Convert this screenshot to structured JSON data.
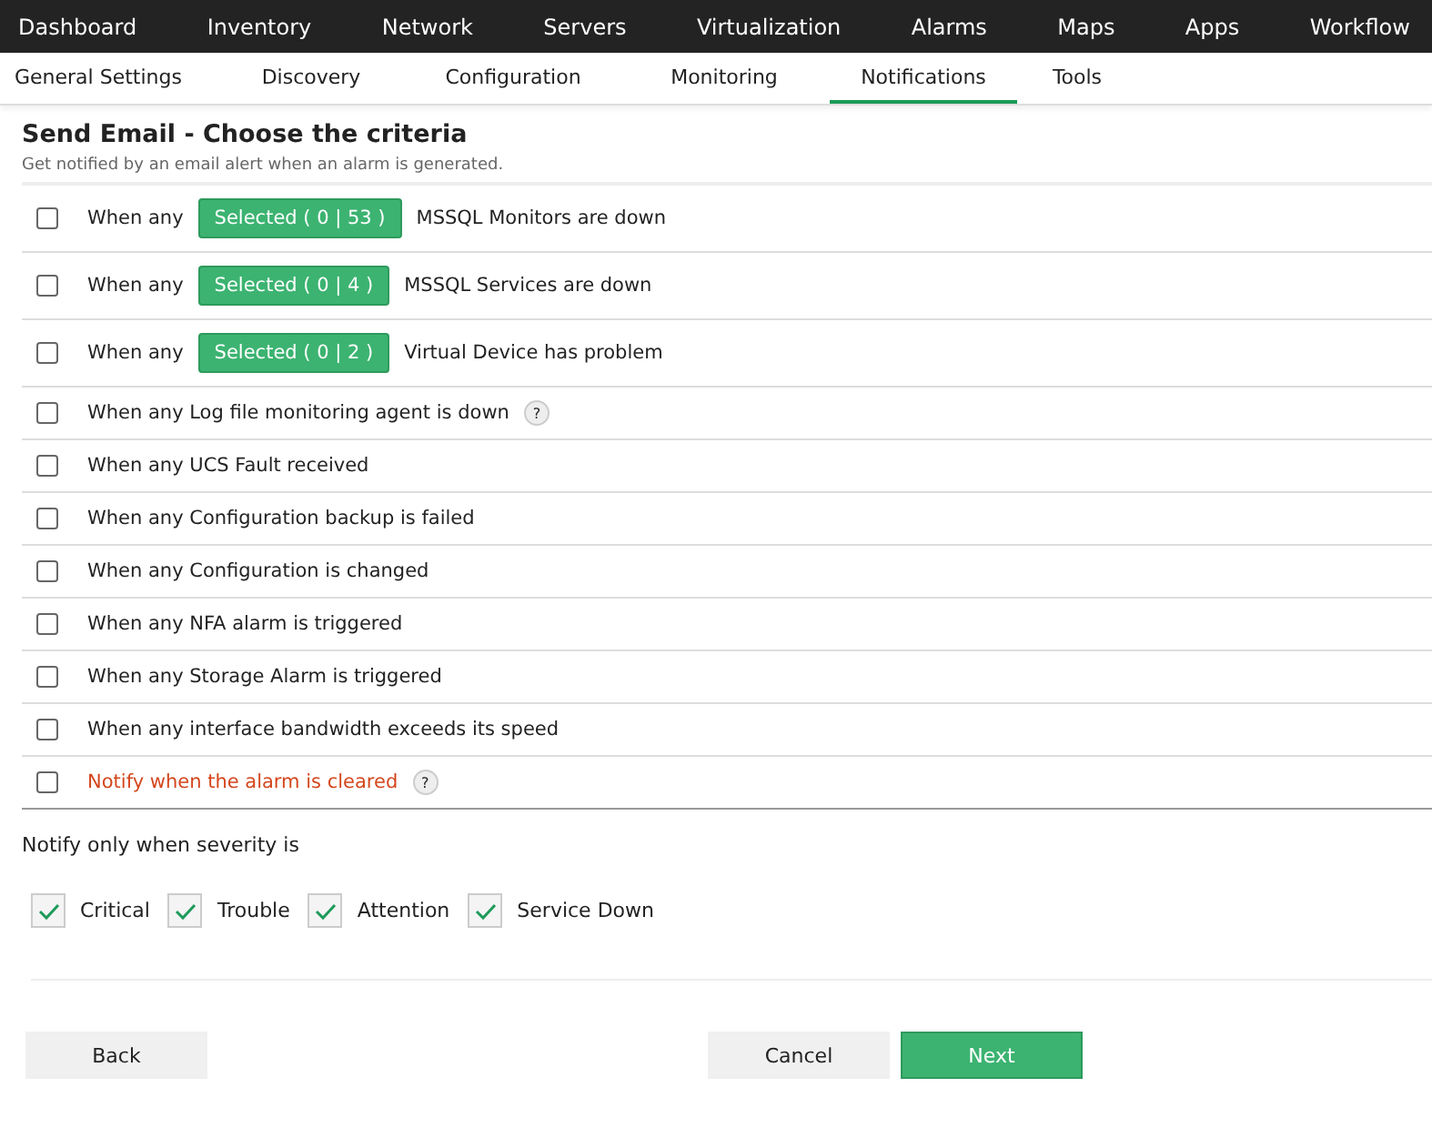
{
  "top_nav": [
    {
      "label": "Dashboard",
      "selected": false
    },
    {
      "label": "Inventory",
      "selected": false
    },
    {
      "label": "Network",
      "selected": false
    },
    {
      "label": "Servers",
      "selected": false
    },
    {
      "label": "Virtualization",
      "selected": false
    },
    {
      "label": "Alarms",
      "selected": false
    },
    {
      "label": "Maps",
      "selected": false
    },
    {
      "label": "Apps",
      "selected": false
    },
    {
      "label": "Workflow",
      "selected": false
    }
  ],
  "tabs": [
    {
      "label": "General Settings",
      "selected": false
    },
    {
      "label": "Discovery",
      "selected": false
    },
    {
      "label": "Configuration",
      "selected": false
    },
    {
      "label": "Monitoring",
      "selected": false
    },
    {
      "label": "Notifications",
      "selected": true
    },
    {
      "label": "Tools",
      "selected": false
    }
  ],
  "title": "Send Email - Choose the criteria",
  "subtitle": "Get notified by an email alert when an alarm is generated.",
  "criteria": [
    {
      "kind": "selector",
      "checked": false,
      "prefix": "When any",
      "button": "Selected ( 0 | 53 )",
      "suffix": "MSSQL Monitors are down"
    },
    {
      "kind": "selector",
      "checked": false,
      "prefix": "When any",
      "button": "Selected ( 0 | 4 )",
      "suffix": "MSSQL Services are down"
    },
    {
      "kind": "selector",
      "checked": false,
      "prefix": "When any",
      "button": "Selected ( 0 | 2 )",
      "suffix": "Virtual Device has problem"
    },
    {
      "kind": "plain",
      "checked": false,
      "text": "When any Log file monitoring agent is down",
      "help": "?"
    },
    {
      "kind": "plain",
      "checked": false,
      "text": "When any UCS Fault received"
    },
    {
      "kind": "plain",
      "checked": false,
      "text": "When any Configuration backup is failed"
    },
    {
      "kind": "plain",
      "checked": false,
      "text": "When any Configuration is changed"
    },
    {
      "kind": "plain",
      "checked": false,
      "text": "When any NFA alarm is triggered"
    },
    {
      "kind": "plain",
      "checked": false,
      "text": "When any Storage Alarm is triggered"
    },
    {
      "kind": "plain",
      "checked": false,
      "text": "When any interface bandwidth exceeds its speed"
    },
    {
      "kind": "notice",
      "checked": false,
      "text": "Notify when the alarm is cleared",
      "help": "?"
    }
  ],
  "severity_label": "Notify only when severity is",
  "severities": [
    {
      "label": "Critical",
      "checked": true
    },
    {
      "label": "Trouble",
      "checked": true
    },
    {
      "label": "Attention",
      "checked": true
    },
    {
      "label": "Service Down",
      "checked": true
    }
  ],
  "buttons": {
    "back": "Back",
    "cancel": "Cancel",
    "next": "Next"
  }
}
